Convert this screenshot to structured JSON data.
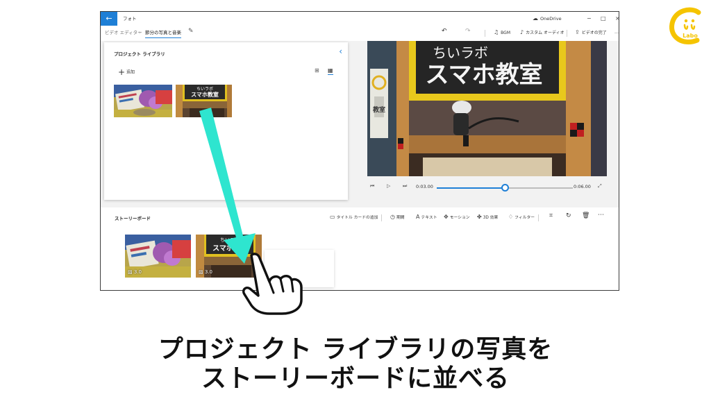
{
  "window": {
    "app_title": "フォト",
    "onedrive_label": "OneDrive",
    "minimize": "−",
    "maximize": "□",
    "close": "×"
  },
  "breadcrumb": {
    "parent": "ビデオ エディター",
    "current": "節分の写真と音楽"
  },
  "toolbar": {
    "undo_icon": "undo-icon",
    "redo_icon": "redo-icon",
    "bgm": "BGM",
    "custom_audio": "カスタム オーディオ",
    "finish_video": "ビデオの完了",
    "more": "…"
  },
  "library": {
    "title": "プロジェクト ライブラリ",
    "add": "追加"
  },
  "player": {
    "current_time": "0:03.00",
    "total_time": "0:06.00",
    "progress": 0.5
  },
  "preview_sign": {
    "line1": "ちいラボ",
    "line2": "スマホ教室"
  },
  "storyboard": {
    "title": "ストーリーボード",
    "tools": {
      "title_card": "タイトル カードの追加",
      "duration": "期間",
      "text": "テキスト",
      "motion": "モーション",
      "effects_3d": "3D 効果",
      "filters": "フィルター"
    },
    "clips": [
      {
        "duration": "3.0"
      },
      {
        "duration": "3.0"
      }
    ]
  },
  "caption": {
    "line1": "プロジェクト ライブラリの写真を",
    "line2": "ストーリーボードに並べる"
  },
  "logo": {
    "text": "Labo"
  },
  "colors": {
    "accent": "#1e7fd6",
    "arrow": "#2ee5cf",
    "logo": "#f5c400"
  }
}
